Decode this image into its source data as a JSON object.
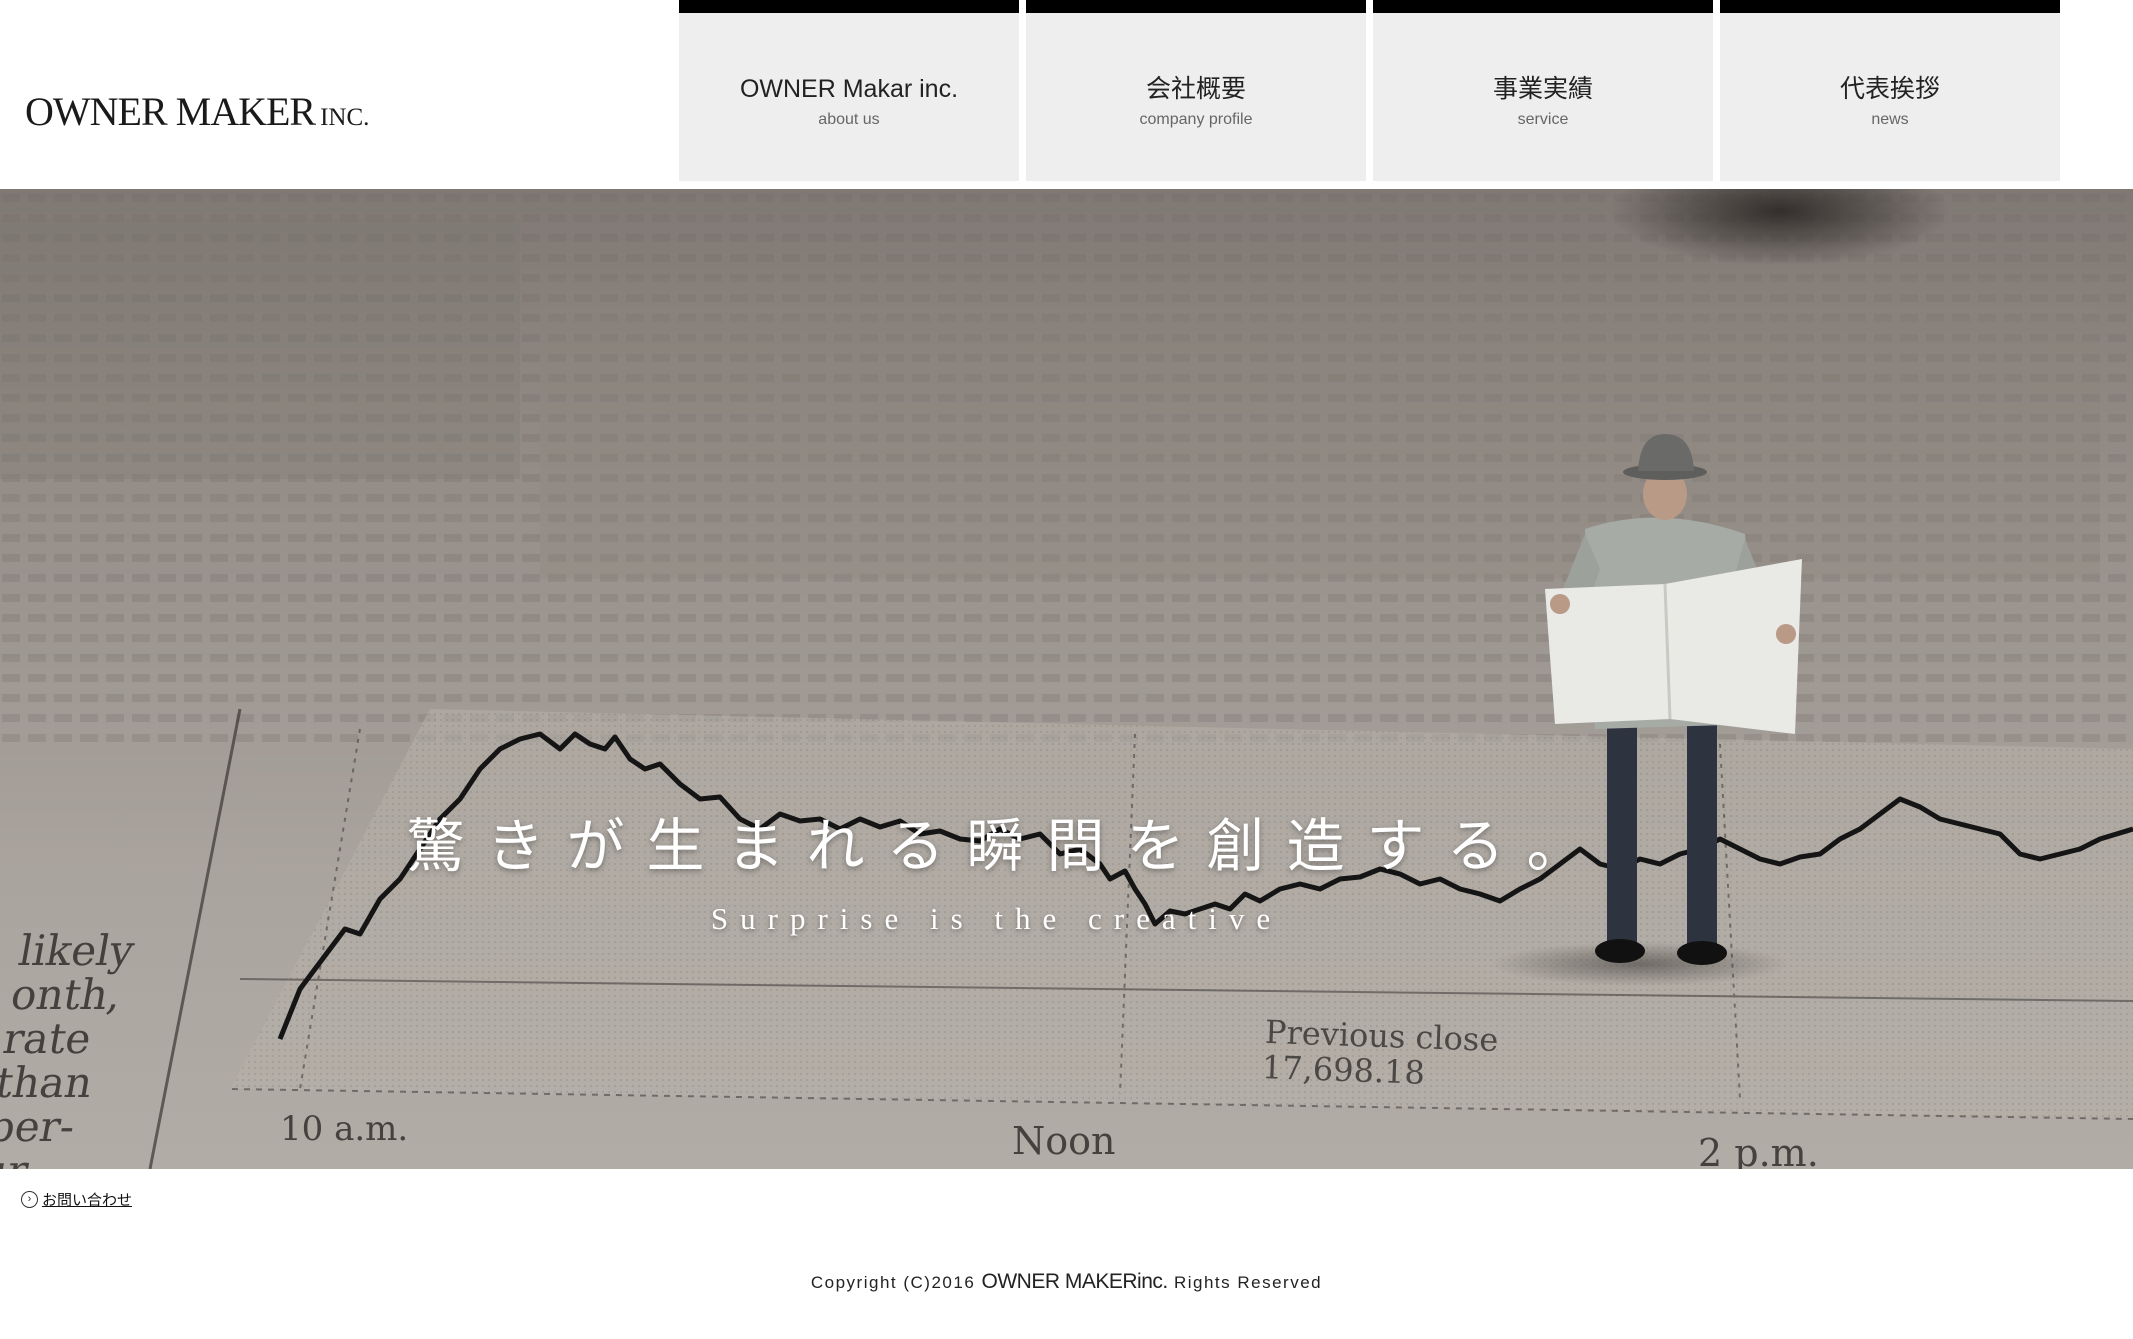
{
  "header": {
    "logo": {
      "main": "OWNER MAKER",
      "suffix": "INC."
    }
  },
  "nav": {
    "items": [
      {
        "label": "OWNER Makar inc.",
        "sublabel": "about us"
      },
      {
        "label": "会社概要",
        "sublabel": "company profile"
      },
      {
        "label": "事業実績",
        "sublabel": "service"
      },
      {
        "label": "代表挨拶",
        "sublabel": "news"
      }
    ]
  },
  "hero": {
    "title": "驚きが生まれる瞬間を創造する。",
    "subtitle": "Surprise is the creative",
    "newspaper": {
      "time_labels": [
        "10 a.m.",
        "Noon",
        "2 p.m."
      ],
      "close_label": "Previous close",
      "close_value": "17,698.18",
      "column_text": [
        "likely",
        "onth,",
        "rate",
        "than",
        "per-",
        "ur-"
      ]
    },
    "colors": {
      "paper": "#a8a29c",
      "ink": "#1e1e1e",
      "text_overlay": "#ffffff"
    }
  },
  "footer": {
    "contact_label": "お問い合わせ",
    "contact_icon": "chevron-right-circle-icon",
    "copyright_prefix": "Copyright (C)2016",
    "copyright_brand": "OWNER MAKERinc.",
    "copyright_suffix": "Rights Reserved"
  }
}
